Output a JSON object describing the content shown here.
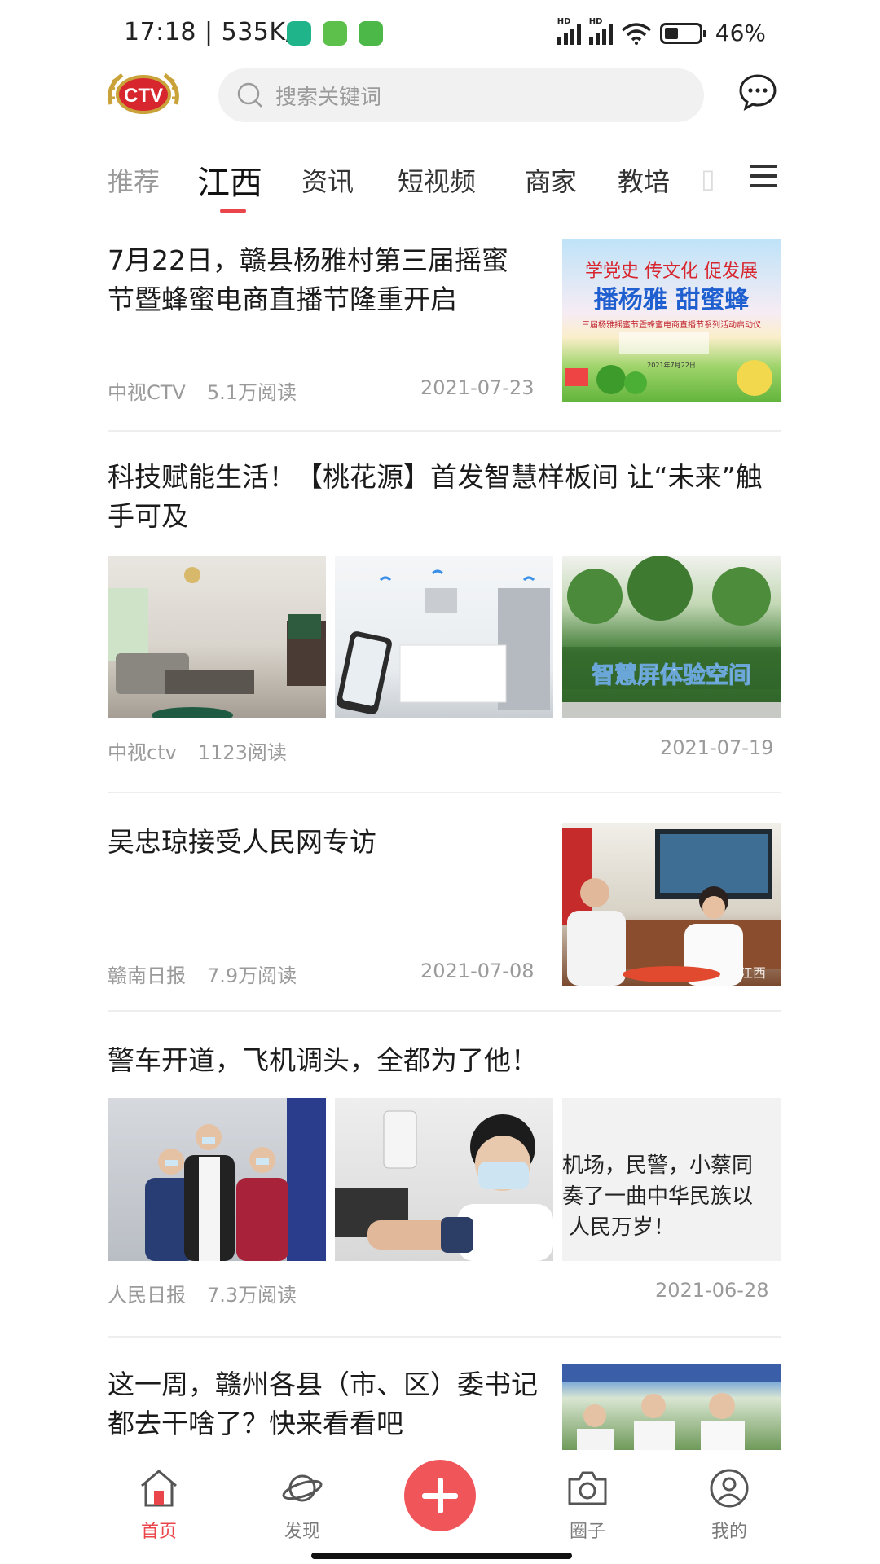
{
  "status_bar": {
    "time": "17:18 | 535K/s",
    "battery": "46%"
  },
  "header": {
    "logo_text": "CTV",
    "search_placeholder": "搜索关键词"
  },
  "tabs": [
    "推荐",
    "江西",
    "资讯",
    "短视频",
    "商家",
    "教培"
  ],
  "active_tab": "江西",
  "articles": [
    {
      "title": "7月22日，赣县杨雅村第三届摇蜜节暨蜂蜜电商直播节隆重开启",
      "source": "中视CTV",
      "reads": "5.1万阅读",
      "date": "2021-07-23",
      "poster_text": {
        "line1": "学党史 传文化 促发展",
        "line2": "播杨雅 甜蜜蜂",
        "line3": "三届杨雅摇蜜节暨蜂蜜电商直播节系列活动启动仪",
        "line4": "2021年7月22日"
      }
    },
    {
      "title": "科技赋能生活！【桃花源】首发智慧样板间 让“未来”触手可及",
      "source": "中视ctv",
      "reads": "1123阅读",
      "date": "2021-07-19",
      "sign_text": "智慧屏体验空间"
    },
    {
      "title": "吴忠琼接受人民网专访",
      "source": "赣南日报",
      "reads": "7.9万阅读",
      "date": "2021-07-08",
      "watermark": "江西"
    },
    {
      "title": "警车开道，飞机调头，全都为了他！",
      "source": "人民日报",
      "reads": "7.3万阅读",
      "date": "2021-06-28",
      "text_thumb": [
        "机场，民警，小蔡同",
        "奏了一曲中华民族以",
        "人民万岁！"
      ]
    },
    {
      "title": "这一周，赣州各县（市、区）委书记都去干啥了？快来看看吧"
    }
  ],
  "bottom_nav": {
    "home": "首页",
    "discover": "发现",
    "circle": "圈子",
    "me": "我的"
  },
  "colors": {
    "accent": "#e9454a",
    "fab": "#f0555a",
    "logo_gold": "#c9a33a",
    "logo_red": "#d8262e"
  }
}
